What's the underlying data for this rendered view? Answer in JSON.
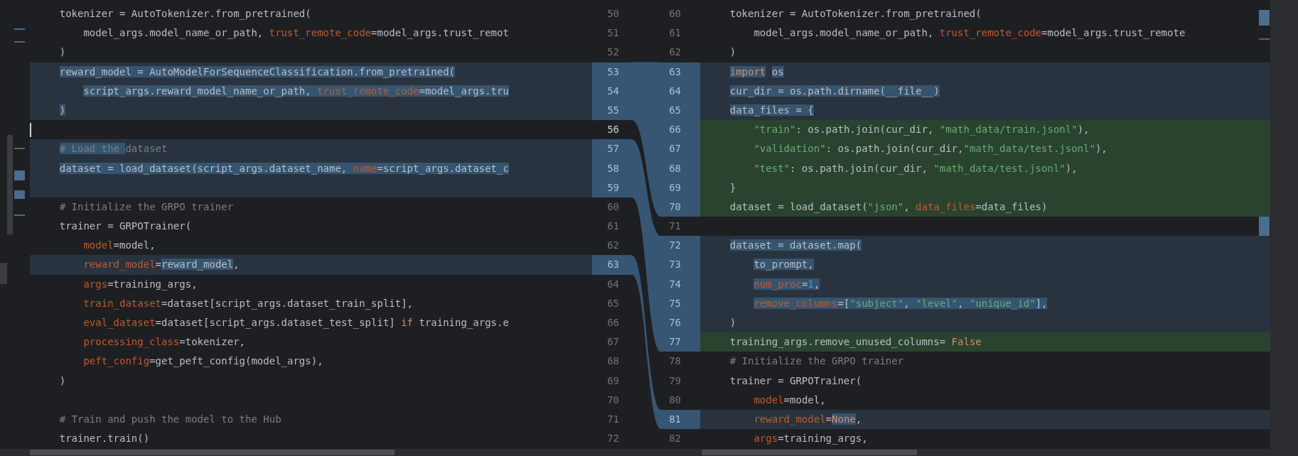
{
  "left_pane": {
    "lines": [
      {
        "number": "50",
        "kind": "normal",
        "segments": [
          {
            "text": "    tokenizer = AutoTokenizer.from_pretrained(",
            "kind": "plain"
          }
        ]
      },
      {
        "number": "51",
        "kind": "normal",
        "segments": [
          {
            "text": "        model_args.model_name_or_path, ",
            "kind": "plain"
          },
          {
            "text": "trust_remote_code",
            "kind": "param"
          },
          {
            "text": "=model_args.trust_remot",
            "kind": "plain"
          }
        ]
      },
      {
        "number": "52",
        "kind": "normal",
        "segments": [
          {
            "text": "    )",
            "kind": "plain"
          }
        ]
      },
      {
        "number": "53",
        "kind": "modified",
        "segments": [
          {
            "text": "    reward_model = AutoModelForSequenceClassification.from_pretrained(",
            "kind": "plain",
            "changed": true
          }
        ]
      },
      {
        "number": "54",
        "kind": "modified",
        "segments": [
          {
            "text": "        script_args.reward_model_name_or_path, ",
            "kind": "plain",
            "changed": true
          },
          {
            "text": "trust_remote_code",
            "kind": "param",
            "changed": true
          },
          {
            "text": "=model_args.tru",
            "kind": "plain",
            "changed": true
          }
        ]
      },
      {
        "number": "55",
        "kind": "modified",
        "segments": [
          {
            "text": "    )",
            "kind": "plain",
            "changed": true
          }
        ]
      },
      {
        "number": "56",
        "kind": "normal",
        "cursor": true
      },
      {
        "number": "57",
        "kind": "modified",
        "segments": [
          {
            "text": "    # Load the ",
            "kind": "comment",
            "changed": true
          },
          {
            "text": "dataset",
            "kind": "comment"
          }
        ]
      },
      {
        "number": "58",
        "kind": "modified",
        "segments": [
          {
            "text": "    dataset = load_dataset(script_args.dataset_name, ",
            "kind": "plain",
            "changed": true
          },
          {
            "text": "name",
            "kind": "param",
            "changed": true
          },
          {
            "text": "=script_args.dataset_c",
            "kind": "plain",
            "changed": true
          }
        ]
      },
      {
        "number": "59",
        "kind": "modified"
      },
      {
        "number": "60",
        "kind": "normal",
        "segments": [
          {
            "text": "    # Initialize the GRPO trainer",
            "kind": "comment"
          }
        ]
      },
      {
        "number": "61",
        "kind": "normal",
        "segments": [
          {
            "text": "    trainer = GRPOTrainer(",
            "kind": "plain"
          }
        ]
      },
      {
        "number": "62",
        "kind": "normal",
        "segments": [
          {
            "text": "        model",
            "kind": "param"
          },
          {
            "text": "=model,",
            "kind": "plain"
          }
        ]
      },
      {
        "number": "63",
        "kind": "modified",
        "segments": [
          {
            "text": "        reward_model",
            "kind": "param"
          },
          {
            "text": "=",
            "kind": "plain"
          },
          {
            "text": "reward_model",
            "kind": "plain",
            "changed": true
          },
          {
            "text": ",",
            "kind": "plain"
          }
        ]
      },
      {
        "number": "64",
        "kind": "normal",
        "segments": [
          {
            "text": "        args",
            "kind": "param"
          },
          {
            "text": "=training_args,",
            "kind": "plain"
          }
        ]
      },
      {
        "number": "65",
        "kind": "normal",
        "segments": [
          {
            "text": "        train_dataset",
            "kind": "param"
          },
          {
            "text": "=dataset[script_args.dataset_train_split],",
            "kind": "plain"
          }
        ]
      },
      {
        "number": "66",
        "kind": "normal",
        "segments": [
          {
            "text": "        eval_dataset",
            "kind": "param"
          },
          {
            "text": "=dataset[script_args.dataset_test_split] ",
            "kind": "plain"
          },
          {
            "text": "if",
            "kind": "keyword"
          },
          {
            "text": " training_args.e",
            "kind": "plain"
          }
        ]
      },
      {
        "number": "67",
        "kind": "normal",
        "segments": [
          {
            "text": "        processing_class",
            "kind": "param"
          },
          {
            "text": "=tokenizer,",
            "kind": "plain"
          }
        ]
      },
      {
        "number": "68",
        "kind": "normal",
        "segments": [
          {
            "text": "        peft_config",
            "kind": "param"
          },
          {
            "text": "=get_peft_config(model_args),",
            "kind": "plain"
          }
        ]
      },
      {
        "number": "69",
        "kind": "normal",
        "segments": [
          {
            "text": "    )",
            "kind": "plain"
          }
        ]
      },
      {
        "number": "70",
        "kind": "normal"
      },
      {
        "number": "71",
        "kind": "normal",
        "segments": [
          {
            "text": "    # Train and push the model to the Hub",
            "kind": "comment"
          }
        ]
      },
      {
        "number": "72",
        "kind": "normal",
        "segments": [
          {
            "text": "    trainer.train()",
            "kind": "plain"
          }
        ]
      }
    ]
  },
  "right_pane": {
    "lines": [
      {
        "number": "60",
        "kind": "normal",
        "segments": [
          {
            "text": "    tokenizer = AutoTokenizer.from_pretrained(",
            "kind": "plain"
          }
        ]
      },
      {
        "number": "61",
        "kind": "normal",
        "segments": [
          {
            "text": "        model_args.model_name_or_path, ",
            "kind": "plain"
          },
          {
            "text": "trust_remote_code",
            "kind": "param"
          },
          {
            "text": "=model_args.trust_remote",
            "kind": "plain"
          }
        ]
      },
      {
        "number": "62",
        "kind": "normal",
        "segments": [
          {
            "text": "    )",
            "kind": "plain"
          }
        ]
      },
      {
        "number": "63",
        "kind": "modified",
        "segments": [
          {
            "text": "    import",
            "kind": "keyword",
            "changed": true
          },
          {
            "text": " os",
            "kind": "plain",
            "changed": true
          }
        ]
      },
      {
        "number": "64",
        "kind": "modified",
        "segments": [
          {
            "text": "    cur_dir = os.path.dirname(__file__)",
            "kind": "plain",
            "changed": true
          }
        ]
      },
      {
        "number": "65",
        "kind": "modified",
        "segments": [
          {
            "text": "    data_files = {",
            "kind": "plain",
            "changed": true
          }
        ]
      },
      {
        "number": "66",
        "kind": "inserted",
        "segments": [
          {
            "text": "        \"train\"",
            "kind": "string"
          },
          {
            "text": ": os.path.join(cur_dir, ",
            "kind": "plain"
          },
          {
            "text": "\"math_data/train.jsonl\"",
            "kind": "string"
          },
          {
            "text": "),",
            "kind": "plain"
          }
        ]
      },
      {
        "number": "67",
        "kind": "inserted",
        "segments": [
          {
            "text": "        \"validation\"",
            "kind": "string"
          },
          {
            "text": ": os.path.join(cur_dir,",
            "kind": "plain"
          },
          {
            "text": "\"math_data/test.jsonl\"",
            "kind": "string"
          },
          {
            "text": "),",
            "kind": "plain"
          }
        ]
      },
      {
        "number": "68",
        "kind": "inserted",
        "segments": [
          {
            "text": "        \"test\"",
            "kind": "string"
          },
          {
            "text": ": os.path.join(cur_dir, ",
            "kind": "plain"
          },
          {
            "text": "\"math_data/test.jsonl\"",
            "kind": "string"
          },
          {
            "text": "),",
            "kind": "plain"
          }
        ]
      },
      {
        "number": "69",
        "kind": "inserted",
        "segments": [
          {
            "text": "    }",
            "kind": "plain"
          }
        ]
      },
      {
        "number": "70",
        "kind": "inserted",
        "segments": [
          {
            "text": "    dataset = load_dataset(",
            "kind": "plain"
          },
          {
            "text": "\"json\"",
            "kind": "string"
          },
          {
            "text": ", ",
            "kind": "plain"
          },
          {
            "text": "data_files",
            "kind": "param"
          },
          {
            "text": "=data_files)",
            "kind": "plain"
          }
        ]
      },
      {
        "number": "71",
        "kind": "normal"
      },
      {
        "number": "72",
        "kind": "modified",
        "segments": [
          {
            "text": "    dataset = dataset.map(",
            "kind": "plain",
            "changed": true
          }
        ]
      },
      {
        "number": "73",
        "kind": "modified",
        "segments": [
          {
            "text": "        to_prompt,",
            "kind": "plain",
            "changed": true
          }
        ]
      },
      {
        "number": "74",
        "kind": "modified",
        "segments": [
          {
            "text": "        num_proc",
            "kind": "param",
            "changed": true
          },
          {
            "text": "=",
            "kind": "plain",
            "changed": true
          },
          {
            "text": "1",
            "kind": "number",
            "changed": true
          },
          {
            "text": ",",
            "kind": "plain",
            "changed": true
          }
        ]
      },
      {
        "number": "75",
        "kind": "modified",
        "segments": [
          {
            "text": "        remove_columns",
            "kind": "param",
            "changed": true
          },
          {
            "text": "=[",
            "kind": "plain",
            "changed": true
          },
          {
            "text": "\"subject\"",
            "kind": "string",
            "changed": true
          },
          {
            "text": ", ",
            "kind": "plain",
            "changed": true
          },
          {
            "text": "\"level\"",
            "kind": "string",
            "changed": true
          },
          {
            "text": ", ",
            "kind": "plain",
            "changed": true
          },
          {
            "text": "\"unique_id\"",
            "kind": "string",
            "changed": true
          },
          {
            "text": "],",
            "kind": "plain",
            "changed": true
          }
        ]
      },
      {
        "number": "76",
        "kind": "modified",
        "segments": [
          {
            "text": "    )",
            "kind": "plain"
          }
        ]
      },
      {
        "number": "77",
        "kind": "inserted",
        "segments": [
          {
            "text": "    training_args.remove_unused_columns= ",
            "kind": "plain"
          },
          {
            "text": "False",
            "kind": "keyword"
          }
        ]
      },
      {
        "number": "78",
        "kind": "normal",
        "segments": [
          {
            "text": "    # Initialize the GRPO trainer",
            "kind": "comment"
          }
        ]
      },
      {
        "number": "79",
        "kind": "normal",
        "segments": [
          {
            "text": "    trainer = GRPOTrainer(",
            "kind": "plain"
          }
        ]
      },
      {
        "number": "80",
        "kind": "normal",
        "segments": [
          {
            "text": "        model",
            "kind": "param"
          },
          {
            "text": "=model,",
            "kind": "plain"
          }
        ]
      },
      {
        "number": "81",
        "kind": "modified",
        "segments": [
          {
            "text": "        reward_model",
            "kind": "param"
          },
          {
            "text": "=",
            "kind": "plain"
          },
          {
            "text": "None",
            "kind": "keyword",
            "changed": true
          },
          {
            "text": ",",
            "kind": "plain"
          }
        ]
      },
      {
        "number": "82",
        "kind": "normal",
        "segments": [
          {
            "text": "        args",
            "kind": "param"
          },
          {
            "text": "=training_args,",
            "kind": "plain"
          }
        ]
      }
    ]
  }
}
